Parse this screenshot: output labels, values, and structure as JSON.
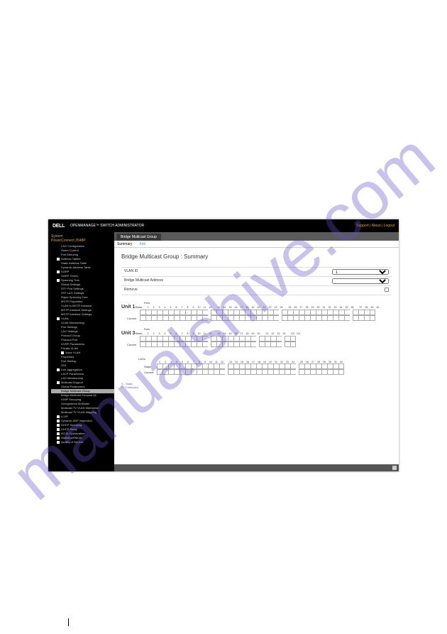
{
  "watermark": "manualshive.com",
  "header": {
    "logo": "DELL",
    "product": "OPENMANAGE™ SWITCH ADMINISTRATOR",
    "links": "Support | About | Logout"
  },
  "sidebar": {
    "system": "System",
    "device": "PowerConnect 3548P",
    "items": [
      {
        "t": "LAG Configuration",
        "cls": "ind2"
      },
      {
        "t": "Storm Control",
        "cls": "ind2"
      },
      {
        "t": "Port Mirroring",
        "cls": "ind2"
      },
      {
        "t": "Address Tables",
        "cls": "ind1",
        "box": true
      },
      {
        "t": "Static Address Table",
        "cls": "ind2"
      },
      {
        "t": "Dynamic Address Table",
        "cls": "ind2"
      },
      {
        "t": "GARP",
        "cls": "ind1",
        "box": true
      },
      {
        "t": "GARP Timers",
        "cls": "ind2"
      },
      {
        "t": "Spanning Tree",
        "cls": "ind1",
        "box": true
      },
      {
        "t": "Global Settings",
        "cls": "ind2"
      },
      {
        "t": "STP Port Settings",
        "cls": "ind2"
      },
      {
        "t": "STP LAG Settings",
        "cls": "ind2"
      },
      {
        "t": "Rapid Spanning Tree",
        "cls": "ind2"
      },
      {
        "t": "MSTP Properties",
        "cls": "ind2"
      },
      {
        "t": "VLAN to MSTP Instance",
        "cls": "ind2"
      },
      {
        "t": "MSTP Instance Settings",
        "cls": "ind2"
      },
      {
        "t": "MSTP Interface Settings",
        "cls": "ind2"
      },
      {
        "t": "VLAN",
        "cls": "ind1",
        "box": true
      },
      {
        "t": "VLAN Membership",
        "cls": "ind2"
      },
      {
        "t": "Port Settings",
        "cls": "ind2"
      },
      {
        "t": "LAG Settings",
        "cls": "ind2"
      },
      {
        "t": "Protocol Group",
        "cls": "ind2"
      },
      {
        "t": "Protocol Port",
        "cls": "ind2"
      },
      {
        "t": "GVRP Parameters",
        "cls": "ind2"
      },
      {
        "t": "Private VLAN",
        "cls": "ind2"
      },
      {
        "t": "Voice VLAN",
        "cls": "ind2",
        "box": true
      },
      {
        "t": "Properties",
        "cls": "ind2"
      },
      {
        "t": "Port Setting",
        "cls": "ind2"
      },
      {
        "t": "OUI",
        "cls": "ind2"
      },
      {
        "t": "Link Aggregation",
        "cls": "ind1",
        "box": true
      },
      {
        "t": "LACP Parameters",
        "cls": "ind2"
      },
      {
        "t": "LAG Membership",
        "cls": "ind2"
      },
      {
        "t": "Multicast Support",
        "cls": "ind1",
        "box": true
      },
      {
        "t": "Global Parameters",
        "cls": "ind2"
      },
      {
        "t": "Bridge Multicast Group",
        "cls": "ind2 active"
      },
      {
        "t": "Bridge Multicast Forward All",
        "cls": "ind2"
      },
      {
        "t": "IGMP Snooping",
        "cls": "ind2"
      },
      {
        "t": "Unregistered Multicast",
        "cls": "ind2"
      },
      {
        "t": "Multicast TV VLAN Membersh",
        "cls": "ind2"
      },
      {
        "t": "Multicast TV VLAN Mapping",
        "cls": "ind2"
      },
      {
        "t": "LLDP",
        "cls": "ind1",
        "box": true
      },
      {
        "t": "Dynamic ARP Inspection",
        "cls": "ind1",
        "box": true
      },
      {
        "t": "DHCP Snooping",
        "cls": "ind1",
        "box": true
      },
      {
        "t": "DHCP Relay",
        "cls": "ind1",
        "box": true
      },
      {
        "t": "iSCSI Optimization",
        "cls": "ind1",
        "box": true
      },
      {
        "t": "Statistics/RMON",
        "cls": "ind1",
        "box": true
      },
      {
        "t": "Quality of Service",
        "cls": "ind1",
        "box": true
      }
    ]
  },
  "tab": "Bridge Multicast Group",
  "subtabs": {
    "summary": "Summary",
    "add": "Add"
  },
  "page_title": "Bridge Multicast Group : Summary",
  "form": {
    "vlan_label": "VLAN ID",
    "vlan_value": "1",
    "bma_label": "Bridge Multicast Address",
    "remove_label": "Remove"
  },
  "units": {
    "u1": {
      "name": "Unit 1",
      "sub": "Static",
      "ports_label": "Ports",
      "row": "Current",
      "nums": [
        "1",
        "2",
        "3",
        "4",
        "5",
        "6",
        "7",
        "8",
        "9",
        "10",
        "11",
        "12",
        "",
        "13",
        "14",
        "15",
        "16",
        "17",
        "18",
        "19",
        "20",
        "21",
        "22",
        "23",
        "24",
        "",
        "25",
        "26",
        "27",
        "28",
        "29",
        "30",
        "31",
        "32",
        "33",
        "34",
        "35",
        "36",
        "",
        "37",
        "38",
        "39",
        "40"
      ]
    },
    "u3": {
      "name": "Unit 3",
      "sub": "Static",
      "ports_label": "Ports",
      "row": "Current",
      "nums": [
        "1",
        "2",
        "3",
        "4",
        "5",
        "6",
        "7",
        "8",
        "9",
        "10",
        "11",
        "12",
        "",
        "13",
        "14",
        "15",
        "16",
        "17",
        "18",
        "19",
        "20",
        "",
        "21",
        "22",
        "23",
        "24",
        "",
        "G3",
        "G4"
      ]
    },
    "lag": {
      "name": "LAGs",
      "row1": "Static",
      "row2": "Current",
      "nums": [
        "1",
        "2",
        "3",
        "4",
        "5",
        "6",
        "7",
        "8",
        "9",
        "10",
        "11",
        "12",
        "",
        "13",
        "14",
        "15",
        "16",
        "17",
        "18",
        "19",
        "20",
        "21",
        "22",
        "23",
        "24",
        "",
        "25",
        "26",
        "27",
        "28",
        "29",
        "30",
        "31",
        "32"
      ]
    }
  },
  "legend": {
    "s": "S - Static",
    "f": "F - Forbidden"
  }
}
